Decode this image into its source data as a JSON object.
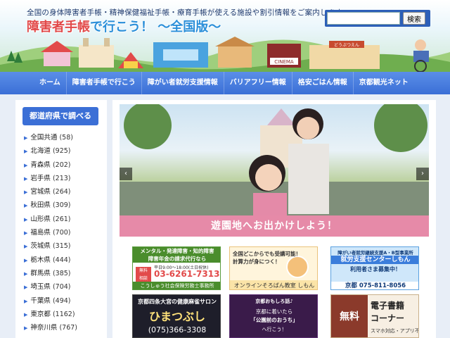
{
  "header": {
    "tagline": "全国の身体障害者手帳・精神保健福祉手帳・療育手帳が使える施設や割引情報をご案内します。",
    "title_prefix": "障害者手帳",
    "title_suffix": "で行こう！ 〜全国版〜",
    "search": {
      "value": "",
      "placeholder": "",
      "button": "検索"
    },
    "sign_zoo": "どうぶつえん",
    "sign_cinema": "CINEMA"
  },
  "nav": {
    "items": [
      {
        "label": "ホーム"
      },
      {
        "label": "障害者手帳で行こう"
      },
      {
        "label": "障がい者就労支援情報"
      },
      {
        "label": "バリアフリー情報"
      },
      {
        "label": "格安ごはん情報"
      },
      {
        "label": "京都観光ネット"
      }
    ]
  },
  "sidebar": {
    "heading": "都道府県で調べる",
    "prefectures": [
      {
        "name": "全国共通",
        "count": "(58)"
      },
      {
        "name": "北海道",
        "count": "(925)"
      },
      {
        "name": "青森県",
        "count": "(202)"
      },
      {
        "name": "岩手県",
        "count": "(213)"
      },
      {
        "name": "宮城県",
        "count": "(264)"
      },
      {
        "name": "秋田県",
        "count": "(309)"
      },
      {
        "name": "山形県",
        "count": "(261)"
      },
      {
        "name": "福島県",
        "count": "(700)"
      },
      {
        "name": "茨城県",
        "count": "(315)"
      },
      {
        "name": "栃木県",
        "count": "(444)"
      },
      {
        "name": "群馬県",
        "count": "(385)"
      },
      {
        "name": "埼玉県",
        "count": "(704)"
      },
      {
        "name": "千葉県",
        "count": "(494)"
      },
      {
        "name": "東京都",
        "count": "(1162)"
      },
      {
        "name": "神奈川県",
        "count": "(767)"
      }
    ]
  },
  "slider": {
    "caption": "遊園地へお出かけしよう！",
    "prev": "‹",
    "next": "›"
  },
  "banners": {
    "b1": {
      "header": "メンタル・発達障害・知的障害\n障害年金の請求代行なら",
      "tag": "無料\n相談",
      "hours": "平日9:00〜18:00(土日祝休)",
      "tel": "03-6261-7313",
      "office": "こうしゅう社会保険労務士事務所"
    },
    "b2": {
      "line1": "全国どこからでも受講可能！",
      "line2": "計算力が身につく！",
      "line3": "オンラインそろばん教室 しもん"
    },
    "b3": {
      "line1": "障がい者就労継続支援A・B型事業所",
      "line2": "就労支援センターしもん",
      "line3": "利用者さま募集中！",
      "line4": "京都 075-811-8056"
    },
    "b4": {
      "line1": "京都四条大宮の健康麻雀サロン",
      "line2": "ひまつぶし",
      "line3": "(075)366-3308"
    },
    "b5": {
      "line1": "京都おもしろ話♪",
      "line2": "京都に着いたら",
      "line3": "「公園前のおうち」",
      "line4": "へ行こう！"
    },
    "b6": {
      "line1": "無料",
      "line2": "電子書籍",
      "line3": "コーナー",
      "line4": "スマホ対応・アプリ不要"
    }
  },
  "colors": {
    "nav": "#3b6fd6",
    "caption": "#e68aa8",
    "accent_red": "#e24a4a"
  }
}
